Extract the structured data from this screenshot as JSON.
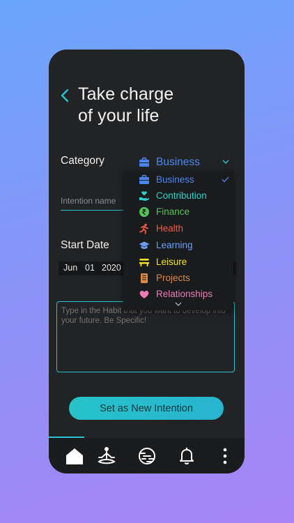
{
  "header": {
    "title_line1": "Take charge",
    "title_line2": "of your life"
  },
  "form": {
    "category_label": "Category",
    "selected_category": "Business",
    "intention_placeholder": "Intention name",
    "start_date_label": "Start Date",
    "date": {
      "month": "Jun",
      "day": "01",
      "year": "2020"
    },
    "habit_placeholder": "Type in the Habit that you want to develop into your future. Be Specific!",
    "submit_label": "Set as New Intention"
  },
  "categories": [
    {
      "label": "Business",
      "color": "#4a86f2",
      "icon": "briefcase-icon",
      "selected": true
    },
    {
      "label": "Contribution",
      "color": "#2ad4cc",
      "icon": "helping-hand-icon"
    },
    {
      "label": "Finance",
      "color": "#56c25a",
      "icon": "rupee-coin-icon"
    },
    {
      "label": "Health",
      "color": "#ef5a45",
      "icon": "running-person-icon"
    },
    {
      "label": "Learning",
      "color": "#6aa0f5",
      "icon": "graduation-cap-icon"
    },
    {
      "label": "Leisure",
      "color": "#f2e424",
      "icon": "bench-icon"
    },
    {
      "label": "Projects",
      "color": "#e08a4a",
      "icon": "notebook-icon"
    },
    {
      "label": "Relationships",
      "color": "#f07ab6",
      "icon": "heart-icon"
    }
  ],
  "tabbar": {
    "icons": [
      "home-icon",
      "meditation-icon",
      "globe-icon",
      "bell-icon",
      "more-icon"
    ],
    "accent": "#29c4cf"
  }
}
